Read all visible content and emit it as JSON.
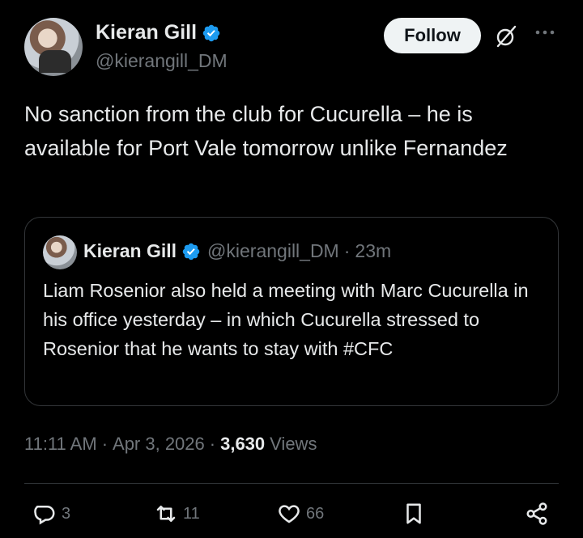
{
  "author": {
    "name": "Kieran Gill",
    "handle": "@kierangill_DM"
  },
  "follow_label": "Follow",
  "tweet": {
    "text": "No sanction from the club for Cucurella – he is available for Port Vale tomorrow unlike Fernandez"
  },
  "quoted": {
    "name": "Kieran Gill",
    "handle": "@kierangill_DM",
    "separator": "·",
    "time": "23m",
    "text": "Liam Rosenior also held a meeting with Marc Cucurella in his office yesterday – in which Cucurella stressed to Rosenior that he wants to stay with #CFC"
  },
  "meta": {
    "time": "11:11 AM",
    "sep1": "·",
    "date": "Apr 3, 2026",
    "sep2": "·",
    "views_count": "3,630",
    "views_label": "Views"
  },
  "actions": {
    "replies": "3",
    "reposts": "11",
    "likes": "66"
  },
  "colors": {
    "background": "#000000",
    "text": "#e7e9ea",
    "muted": "#71767b",
    "verified": "#1d9bf0",
    "border": "#333639"
  },
  "icons": [
    "verified-badge-icon",
    "grok-icon",
    "more-icon",
    "reply-icon",
    "repost-icon",
    "like-icon",
    "bookmark-icon",
    "share-icon"
  ]
}
